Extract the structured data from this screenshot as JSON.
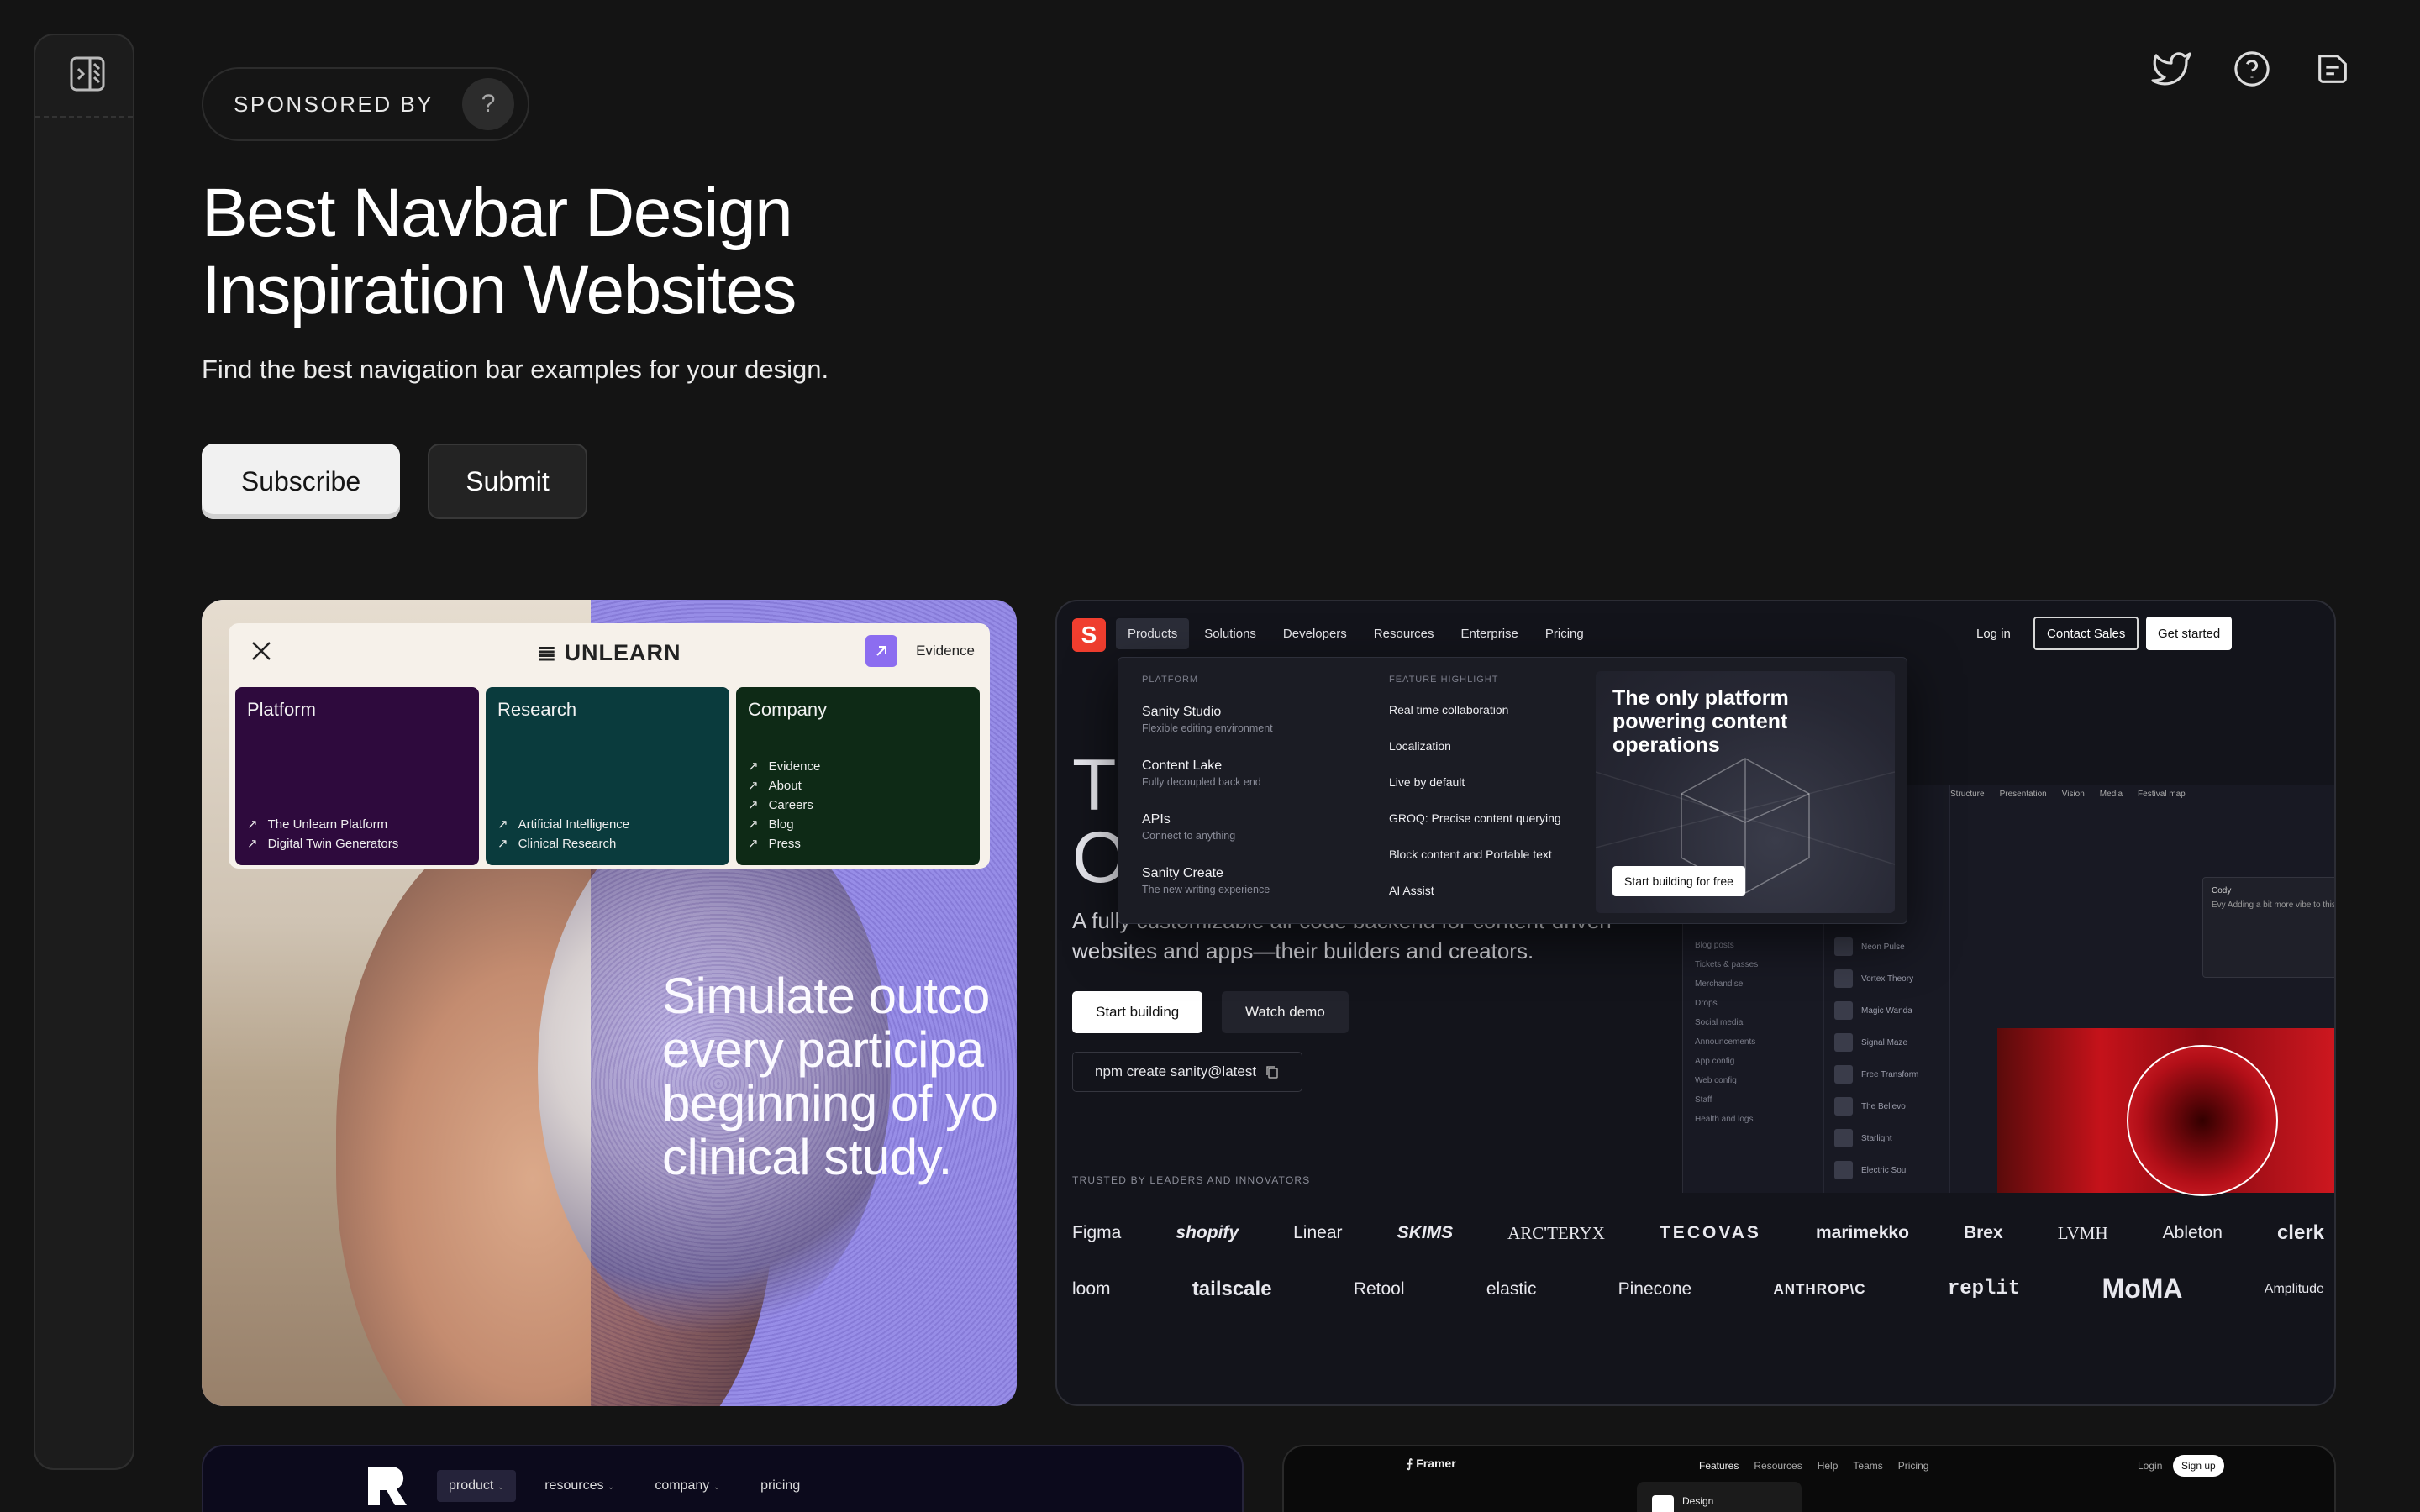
{
  "sponsor": {
    "label": "SPONSORED BY",
    "help": "?"
  },
  "hero": {
    "title_line1": "Best Navbar Design",
    "title_line2": "Inspiration Websites",
    "subtitle": "Find the best navigation bar examples for your design.",
    "subscribe_label": "Subscribe",
    "submit_label": "Submit"
  },
  "top_icons": [
    "twitter-icon",
    "help-icon",
    "changelog-icon"
  ],
  "unlearn": {
    "logo": "UNLEARN",
    "evidence_label": "Evidence",
    "tiles": [
      {
        "title": "Platform",
        "links": [
          "The Unlearn Platform",
          "Digital Twin Generators"
        ]
      },
      {
        "title": "Research",
        "links": [
          "Artificial Intelligence",
          "Clinical Research"
        ]
      },
      {
        "title": "Company",
        "links": [
          "Evidence",
          "About",
          "Careers",
          "Blog",
          "Press"
        ]
      }
    ],
    "headline": "Simulate outco\nevery participa\nbeginning of yo\nclinical study."
  },
  "sanity": {
    "logo": "S",
    "nav": [
      "Products",
      "Solutions",
      "Developers",
      "Resources",
      "Enterprise",
      "Pricing"
    ],
    "login": "Log in",
    "contact": "Contact Sales",
    "get_started": "Get started",
    "platform_label": "PLATFORM",
    "feature_label": "FEATURE HIGHLIGHT",
    "products": [
      {
        "name": "Sanity Studio",
        "desc": "Flexible editing environment"
      },
      {
        "name": "Content Lake",
        "desc": "Fully decoupled back end"
      },
      {
        "name": "APIs",
        "desc": "Connect to anything"
      },
      {
        "name": "Sanity Create",
        "desc": "The new writing experience"
      }
    ],
    "features": [
      "Real time collaboration",
      "Localization",
      "Live by default",
      "GROQ: Precise content querying",
      "Block content and Portable text",
      "AI Assist"
    ],
    "promo_title": "The only platform\npowering content\noperations",
    "promo_button": "Start building for free",
    "hero_big": "T\nO",
    "description": "A fully customizable all-code backend for content-driven\nwebsites and apps—their builders and creators.",
    "start_building": "Start building",
    "watch_demo": "Watch demo",
    "npm": "npm create sanity@latest",
    "app_side": [
      "Blog posts",
      "Tickets & passes",
      "Merchandise",
      "Drops",
      "Social media",
      "Announcements",
      "App config",
      "Web config",
      "Staff",
      "Health and logs"
    ],
    "app_list": [
      "Neon Pulse",
      "Vortex Theory",
      "Magic Wanda",
      "Signal Maze",
      "Free Transform",
      "The Bellevo",
      "Starlight",
      "Electric Soul"
    ],
    "app_tabs": [
      "Structure",
      "Presentation",
      "Vision",
      "Media",
      "Festival map"
    ],
    "comment_author": "Cody",
    "comment_text": "Evy Adding a bit more vibe to this, wdyt?",
    "trusted_label": "TRUSTED BY LEADERS AND INNOVATORS",
    "logos_row1": [
      "Figma",
      "shopify",
      "Linear",
      "SKIMS",
      "ARC'TERYX",
      "TECOVAS",
      "marimekko",
      "Brex",
      "LVMH",
      "Ableton",
      "clerk"
    ],
    "logos_row2": [
      "loom",
      "tailscale",
      "Retool",
      "elastic",
      "Pinecone",
      "ANTHROP\\C",
      "replit",
      "MoMA",
      "Amplitude"
    ]
  },
  "card3": {
    "nav": [
      "product",
      "resources",
      "company",
      "pricing"
    ]
  },
  "framer": {
    "logo": "Framer",
    "nav": [
      "Features",
      "Resources",
      "Help",
      "Teams",
      "Pricing"
    ],
    "login": "Login",
    "signup": "Sign up",
    "dropdown_label": "Design"
  }
}
